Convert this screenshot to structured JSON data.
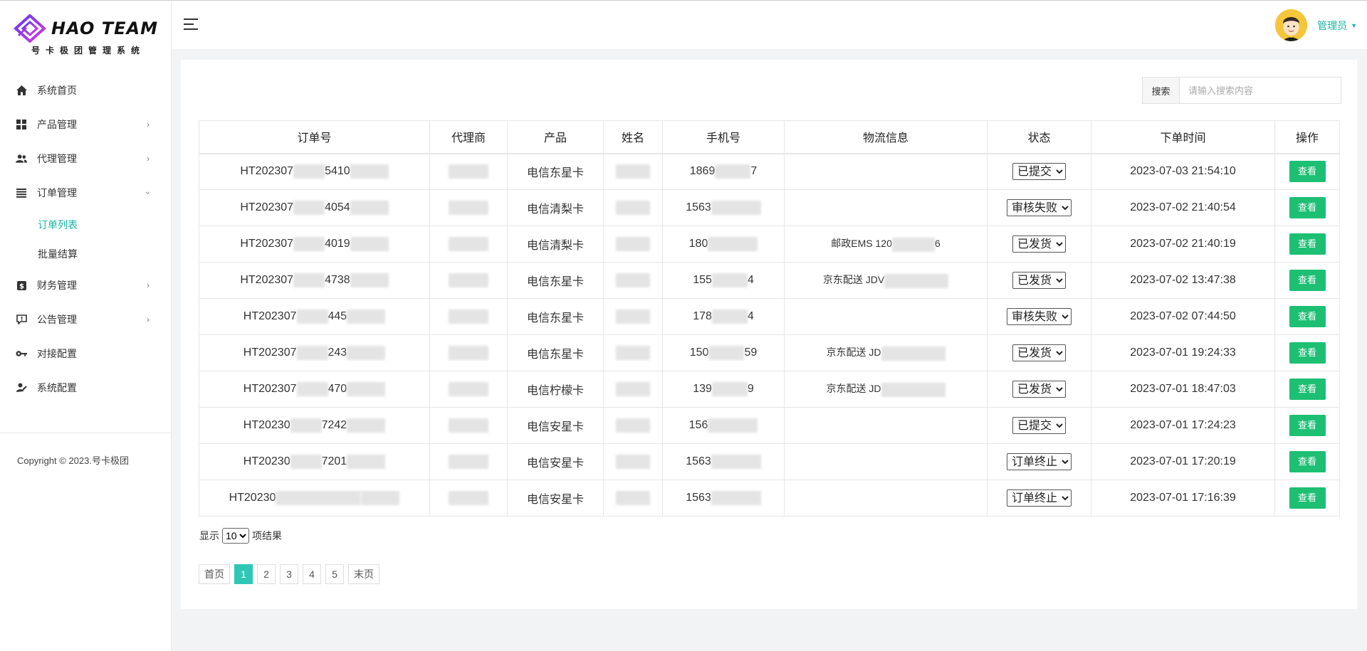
{
  "brand": {
    "title": "HAO TEAM",
    "subtitle": "号卡极团管理系统"
  },
  "sidebar": {
    "items": [
      {
        "label": "系统首页",
        "icon": "home-icon"
      },
      {
        "label": "产品管理",
        "icon": "grid-icon",
        "has_children": true
      },
      {
        "label": "代理管理",
        "icon": "users-icon",
        "has_children": true
      },
      {
        "label": "订单管理",
        "icon": "list-icon",
        "has_children": true,
        "expanded": true,
        "children": [
          {
            "label": "订单列表",
            "active": true
          },
          {
            "label": "批量结算"
          }
        ]
      },
      {
        "label": "财务管理",
        "icon": "dollar-icon",
        "has_children": true
      },
      {
        "label": "公告管理",
        "icon": "announce-icon",
        "has_children": true
      },
      {
        "label": "对接配置",
        "icon": "key-icon"
      },
      {
        "label": "系统配置",
        "icon": "user-gear-icon"
      }
    ],
    "copyright": "Copyright © 2023.号卡极团"
  },
  "header": {
    "user_name": "管理员"
  },
  "search": {
    "label": "搜索",
    "placeholder": "请输入搜索内容"
  },
  "table": {
    "columns": [
      "订单号",
      "代理商",
      "产品",
      "姓名",
      "手机号",
      "物流信息",
      "状态",
      "下单时间",
      "操作"
    ],
    "rows": [
      {
        "order_a": "HT202307",
        "order_b": "5410",
        "product": "电信东星卡",
        "phone_a": "1869",
        "phone_b": "7",
        "logistics": "",
        "status": "已提交",
        "time": "2023-07-03 21:54:10",
        "action": "查看"
      },
      {
        "order_a": "HT202307",
        "order_b": "4054",
        "product": "电信清梨卡",
        "phone_a": "1563",
        "phone_b": "",
        "logistics": "",
        "status": "审核失败",
        "time": "2023-07-02 21:40:54",
        "action": "查看"
      },
      {
        "order_a": "HT202307",
        "order_b": "4019",
        "product": "电信清梨卡",
        "phone_a": "180",
        "phone_b": "",
        "logistics": "邮政EMS 120",
        "logistics_tail": "6",
        "status": "已发货",
        "time": "2023-07-02 21:40:19",
        "action": "查看"
      },
      {
        "order_a": "HT202307",
        "order_b": "4738",
        "product": "电信东星卡",
        "phone_a": "155",
        "phone_b": "4",
        "logistics": "京东配送 JDV",
        "logistics_tail": "",
        "status": "已发货",
        "time": "2023-07-02 13:47:38",
        "action": "查看"
      },
      {
        "order_a": "HT202307",
        "order_b": "445",
        "product": "电信东星卡",
        "phone_a": "178",
        "phone_b": "4",
        "logistics": "",
        "status": "审核失败",
        "time": "2023-07-02 07:44:50",
        "action": "查看"
      },
      {
        "order_a": "HT202307",
        "order_b": "243",
        "product": "电信东星卡",
        "phone_a": "150",
        "phone_b": "59",
        "logistics": "京东配送 JD",
        "logistics_tail": "",
        "status": "已发货",
        "time": "2023-07-01 19:24:33",
        "action": "查看"
      },
      {
        "order_a": "HT202307",
        "order_b": "470",
        "product": "电信柠檬卡",
        "phone_a": "139",
        "phone_b": "9",
        "logistics": "京东配送 JD",
        "logistics_tail": "",
        "status": "已发货",
        "time": "2023-07-01 18:47:03",
        "action": "查看"
      },
      {
        "order_a": "HT20230",
        "order_b": "7242",
        "product": "电信安星卡",
        "phone_a": "156",
        "phone_b": "",
        "logistics": "",
        "status": "已提交",
        "time": "2023-07-01 17:24:23",
        "action": "查看"
      },
      {
        "order_a": "HT20230",
        "order_b": "7201",
        "product": "电信安星卡",
        "phone_a": "1563",
        "phone_b": "",
        "logistics": "",
        "status": "订单终止",
        "time": "2023-07-01 17:20:19",
        "action": "查看"
      },
      {
        "order_a": "HT20230",
        "order_b": "",
        "product": "电信安星卡",
        "phone_a": "1563",
        "phone_b": "",
        "logistics": "",
        "status": "订单终止",
        "time": "2023-07-01 17:16:39",
        "action": "查看"
      }
    ],
    "status_options": [
      "已提交",
      "审核失败",
      "已发货",
      "订单终止"
    ]
  },
  "page_size": {
    "prefix": "显示",
    "value": "10",
    "suffix": "项结果"
  },
  "pagination": {
    "first": "首页",
    "pages": [
      "1",
      "2",
      "3",
      "4",
      "5"
    ],
    "current": "1",
    "last": "末页"
  },
  "colors": {
    "accent": "#17b3a3",
    "button_green": "#1dbf73",
    "page_active": "#2ec7b5"
  }
}
